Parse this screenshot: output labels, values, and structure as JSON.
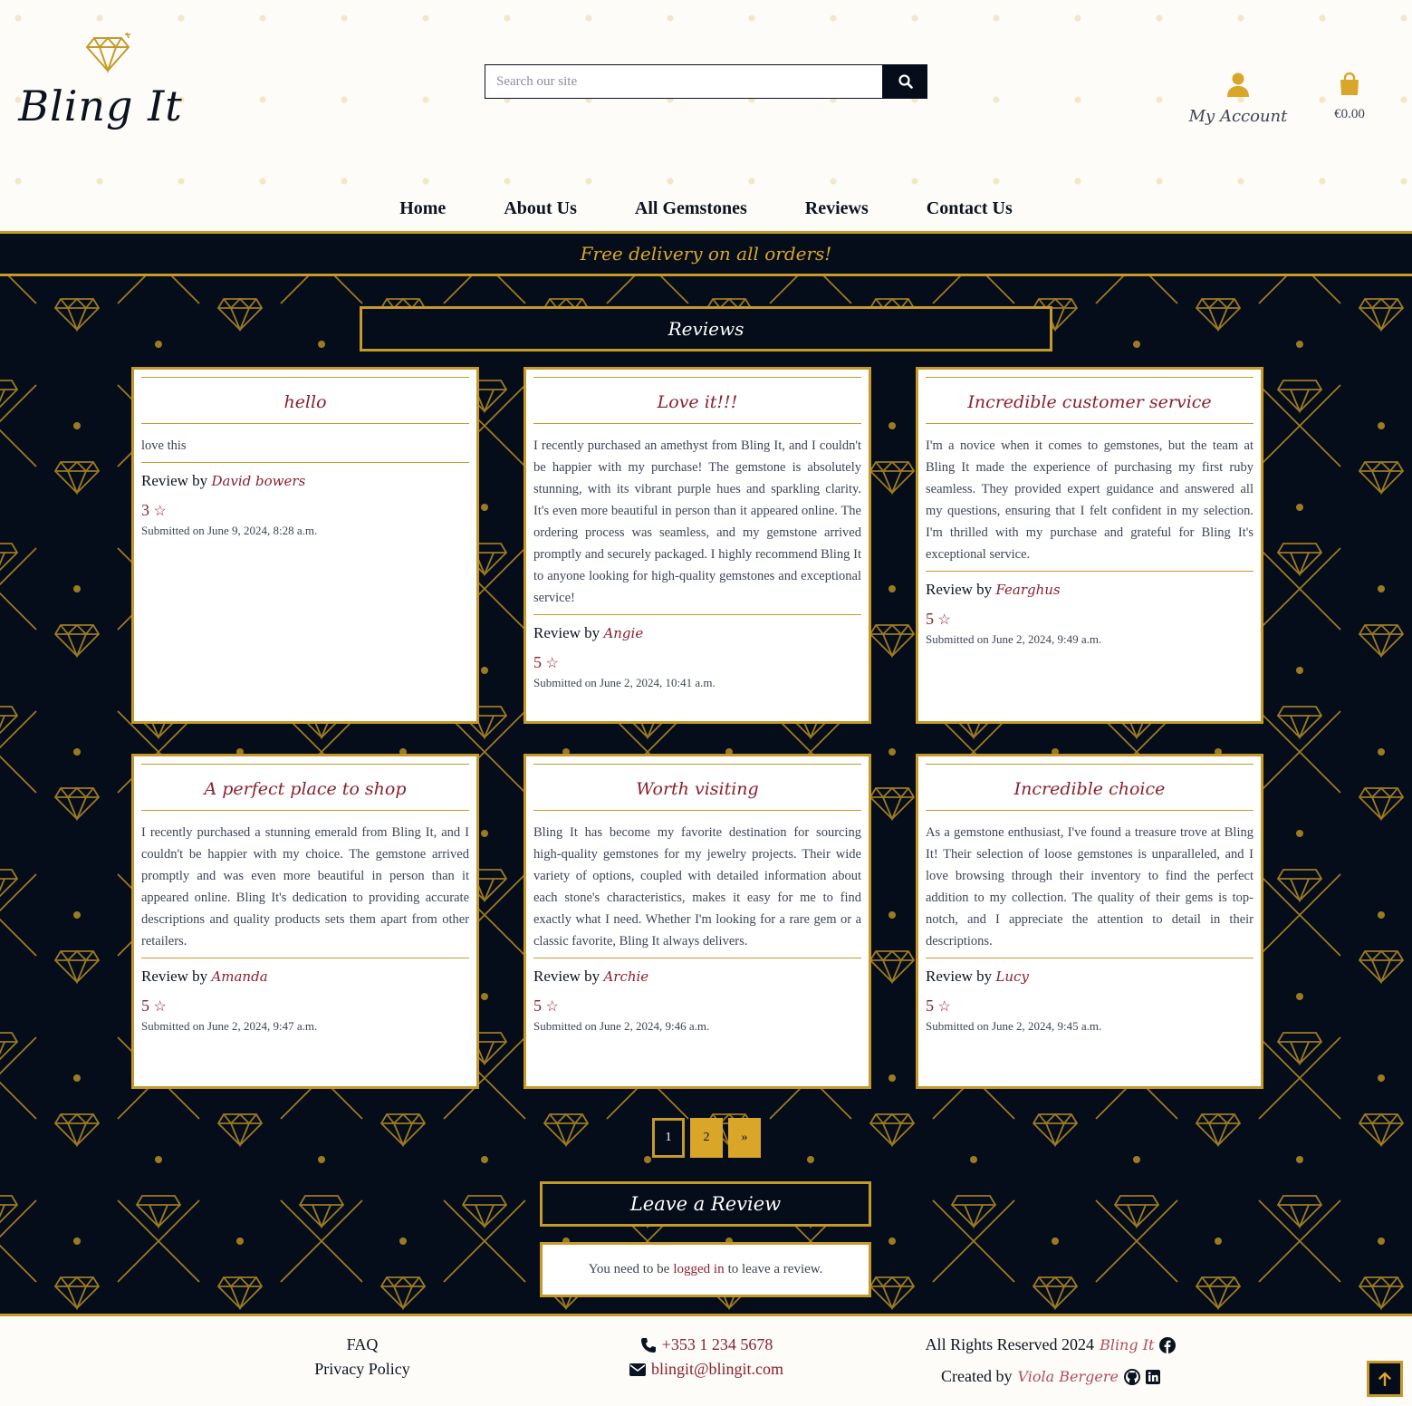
{
  "brand": {
    "name": "Bling It",
    "logo_icon": "diamond-icon"
  },
  "search": {
    "placeholder": "Search our site",
    "button_icon": "search-icon"
  },
  "account": {
    "label": "My Account",
    "icon": "user-icon"
  },
  "cart": {
    "total": "€0.00",
    "icon": "shopping-bag-icon"
  },
  "nav": {
    "items": [
      {
        "label": "Home"
      },
      {
        "label": "About Us"
      },
      {
        "label": "All Gemstones"
      },
      {
        "label": "Reviews"
      },
      {
        "label": "Contact Us"
      }
    ]
  },
  "banner": {
    "text": "Free delivery on all orders!"
  },
  "reviews": {
    "heading": "Reviews",
    "by_label": "Review by",
    "star_icon": "star-outline-icon",
    "items": [
      {
        "title": "hello",
        "body": "love this",
        "author": "David bowers",
        "rating": "3",
        "date": "Submitted on June 9, 2024, 8:28 a.m."
      },
      {
        "title": "Love it!!!",
        "body": "I recently purchased an amethyst from Bling It, and I couldn't be happier with my purchase! The gemstone is absolutely stunning, with its vibrant purple hues and sparkling clarity. It's even more beautiful in person than it appeared online. The ordering process was seamless, and my gemstone arrived promptly and securely packaged. I highly recommend Bling It to anyone looking for high-quality gemstones and exceptional service!",
        "author": "Angie",
        "rating": "5",
        "date": "Submitted on June 2, 2024, 10:41 a.m."
      },
      {
        "title": "Incredible customer service",
        "body": "I'm a novice when it comes to gemstones, but the team at Bling It made the experience of purchasing my first ruby seamless. They provided expert guidance and answered all my questions, ensuring that I felt confident in my selection. I'm thrilled with my purchase and grateful for Bling It's exceptional service.",
        "author": "Fearghus",
        "rating": "5",
        "date": "Submitted on June 2, 2024, 9:49 a.m."
      },
      {
        "title": "A perfect place to shop",
        "body": "I recently purchased a stunning emerald from Bling It, and I couldn't be happier with my choice. The gemstone arrived promptly and was even more beautiful in person than it appeared online. Bling It's dedication to providing accurate descriptions and quality products sets them apart from other retailers.",
        "author": "Amanda",
        "rating": "5",
        "date": "Submitted on June 2, 2024, 9:47 a.m."
      },
      {
        "title": "Worth visiting",
        "body": "Bling It has become my favorite destination for sourcing high-quality gemstones for my jewelry projects. Their wide variety of options, coupled with detailed information about each stone's characteristics, makes it easy for me to find exactly what I need. Whether I'm looking for a rare gem or a classic favorite, Bling It always delivers.",
        "author": "Archie",
        "rating": "5",
        "date": "Submitted on June 2, 2024, 9:46 a.m."
      },
      {
        "title": "Incredible choice",
        "body": "As a gemstone enthusiast, I've found a treasure trove at Bling It! Their selection of loose gemstones is unparalleled, and I love browsing through their inventory to find the perfect addition to my collection. The quality of their gems is top-notch, and I appreciate the attention to detail in their descriptions.",
        "author": "Lucy",
        "rating": "5",
        "date": "Submitted on June 2, 2024, 9:45 a.m."
      }
    ]
  },
  "pagination": {
    "current": "1",
    "next_page": "2",
    "next": "»"
  },
  "leave_review": {
    "heading": "Leave a Review",
    "prefix": "You need to be",
    "link": "logged in",
    "suffix": "to leave a review."
  },
  "footer": {
    "faq": "FAQ",
    "privacy": "Privacy Policy",
    "phone": "+353 1 234 5678",
    "email": "blingit@blingit.com",
    "rights": "All Rights Reserved 2024",
    "brand": "Bling It",
    "created_by": "Created by",
    "creator": "Viola Bergere"
  },
  "colors": {
    "gold": "#c69a2a",
    "navy": "#050d1a",
    "accent_red": "#8a1f2e"
  }
}
